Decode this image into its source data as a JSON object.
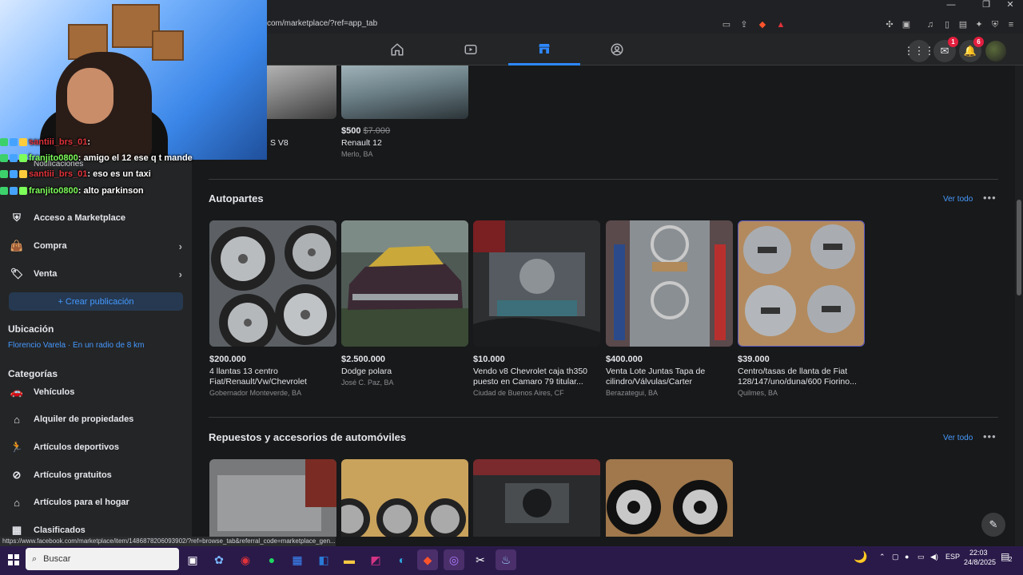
{
  "browser": {
    "url": "com/marketplace/?ref=app_tab",
    "status_url": "https://www.facebook.com/marketplace/item/1486878206093902/?ref=browse_tab&referral_code=marketplace_gen..."
  },
  "fb_nav": {
    "messenger_badge": "1",
    "notifications_badge": "6"
  },
  "top_listings": [
    {
      "price": "",
      "old_price": "",
      "title": "S V8",
      "loc": ""
    },
    {
      "price": "$500",
      "old_price": "$7.000",
      "title": "Renault 12",
      "loc": "Merlo, BA"
    }
  ],
  "sidebar": {
    "notifications_label": "Notificaciones",
    "items": [
      {
        "label": "Acceso a Marketplace",
        "icon": "shield-icon"
      },
      {
        "label": "Compra",
        "icon": "bag-icon"
      },
      {
        "label": "Venta",
        "icon": "tag-icon"
      }
    ],
    "create_button": "+ Crear publicación",
    "location_heading": "Ubicación",
    "location_value": "Florencio Varela · En un radio de 8 km",
    "categories_heading": "Categorías",
    "categories": [
      {
        "label": "Vehículos",
        "icon": "car-icon"
      },
      {
        "label": "Alquiler de propiedades",
        "icon": "house-key-icon"
      },
      {
        "label": "Artículos deportivos",
        "icon": "runner-icon"
      },
      {
        "label": "Artículos gratuitos",
        "icon": "free-tag-icon"
      },
      {
        "label": "Artículos para el hogar",
        "icon": "home-icon"
      },
      {
        "label": "Clasificados",
        "icon": "classified-icon"
      }
    ]
  },
  "chat": [
    {
      "user": "santiii_brs_01",
      "msg": ":",
      "color": "red"
    },
    {
      "user": "franjito0800",
      "msg": ": amigo el 12 ese q t mande",
      "color": "green"
    },
    {
      "user": "santiii_brs_01",
      "msg": ": eso es un taxi",
      "color": "red"
    },
    {
      "user": "franjito0800",
      "msg": ": alto parkinson",
      "color": "green"
    }
  ],
  "sections": [
    {
      "heading": "Autopartes",
      "see_all": "Ver todo",
      "listings": [
        {
          "price": "$200.000",
          "title": "4 llantas 13 centro Fiat/Renault/Vw/Chevrolet",
          "loc": "Gobernador Monteverde, BA"
        },
        {
          "price": "$2.500.000",
          "title": "Dodge polara",
          "loc": "José C. Paz, BA"
        },
        {
          "price": "$10.000",
          "title": "Vendo v8 Chevrolet caja th350 puesto en Camaro 79 titular...",
          "loc": "Ciudad de Buenos Aires, CF"
        },
        {
          "price": "$400.000",
          "title": "Venta Lote Juntas Tapa de cilindro/Válvulas/Carter",
          "loc": "Berazategui, BA"
        },
        {
          "price": "$39.000",
          "title": "Centro/tasas de llanta de Fiat 128/147/uno/duna/600 Fiorino...",
          "loc": "Quilmes, BA"
        }
      ]
    },
    {
      "heading": "Repuestos y accesorios de automóviles",
      "see_all": "Ver todo"
    }
  ],
  "taskbar": {
    "search_placeholder": "Buscar",
    "lang": "ESP",
    "time": "22:03",
    "date": "24/8/2025",
    "notif_count": "2"
  }
}
